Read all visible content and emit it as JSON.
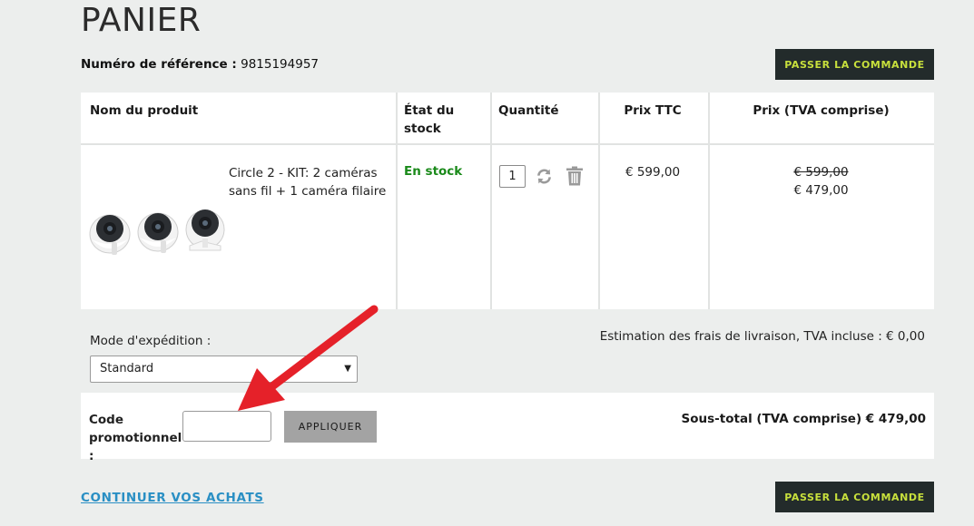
{
  "page": {
    "title": "PANIER",
    "reference_label": "Numéro de référence :",
    "reference_value": "9815194957"
  },
  "buttons": {
    "checkout_top": "PASSER LA COMMANDE",
    "checkout_bottom": "PASSER LA COMMANDE",
    "apply": "APPLIQUER",
    "continue": "CONTINUER VOS ACHATS"
  },
  "table": {
    "headers": {
      "product": "Nom du produit",
      "stock": "État du stock",
      "quantity": "Quantité",
      "price_ttc": "Prix TTC",
      "price_vat": "Prix (TVA comprise)"
    },
    "row": {
      "product_name": "Circle 2 - KIT: 2 caméras sans fil + 1 caméra filaire",
      "stock_status": "En stock",
      "quantity": "1",
      "price_ttc": "€ 599,00",
      "price_old": "€ 599,00",
      "price_new": "€ 479,00"
    }
  },
  "shipping": {
    "label": "Mode d'expédition :",
    "selected": "Standard",
    "estimate": "Estimation des frais de livraison, TVA incluse :  € 0,00"
  },
  "promo": {
    "label": "Code promotionnel :",
    "value": ""
  },
  "subtotal": "Sous-total (TVA comprise) € 479,00",
  "colors": {
    "background": "#eceeed",
    "checkout_bg": "#232b2b",
    "checkout_text": "#c8e03c",
    "stock_green": "#1a8a1a",
    "link_blue": "#2a8fc4",
    "annotation_red": "#e52129",
    "apply_bg": "#a3a3a3"
  },
  "icons": [
    "refresh-icon",
    "trash-icon",
    "chevron-down-icon",
    "camera-product-image",
    "annotation-arrow"
  ]
}
